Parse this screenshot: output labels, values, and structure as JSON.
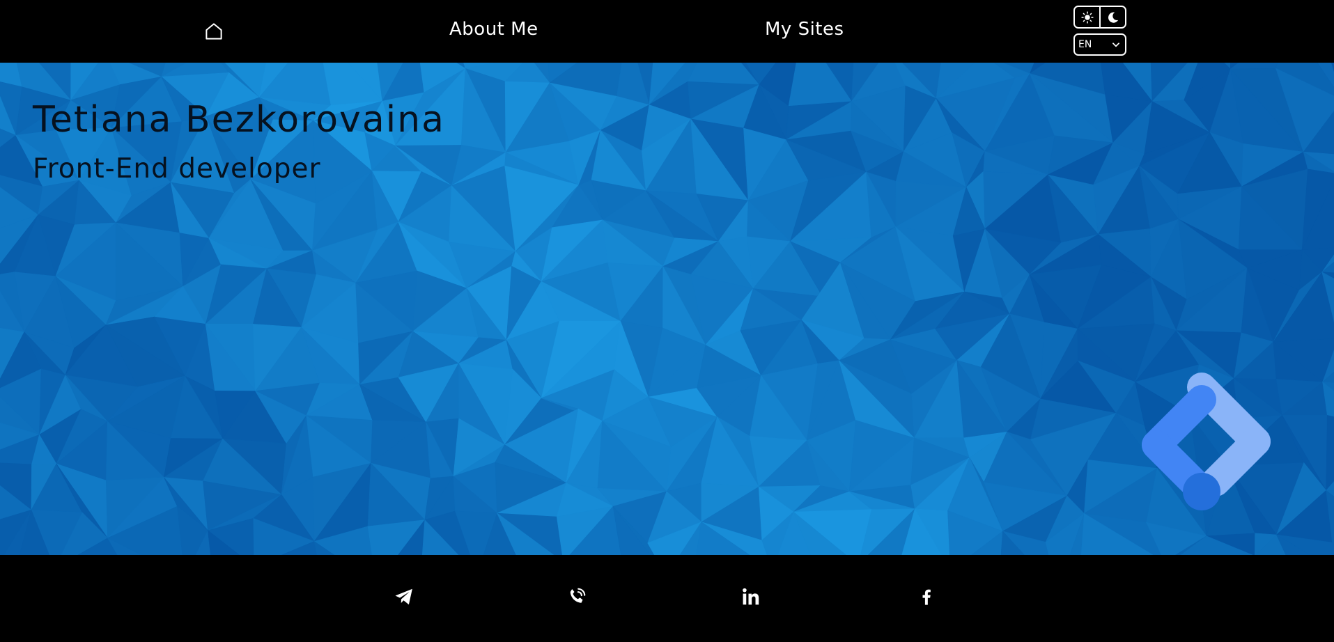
{
  "header": {
    "home_icon": "home-icon",
    "nav": [
      {
        "label": "About Me"
      },
      {
        "label": "My Sites"
      }
    ],
    "theme_toggle": {
      "light_icon": "sun-icon",
      "dark_icon": "moon-icon"
    },
    "language": {
      "selected": "EN",
      "icon": "chevron-down-icon"
    }
  },
  "hero": {
    "name": "Tetiana Bezkorovaina",
    "role": "Front-End developer",
    "logo": "google-tag-manager-logo",
    "colors": {
      "background": "#0a7acb",
      "text": "#06111f",
      "logo_dark": "#4285f4",
      "logo_light": "#8ab4f8",
      "logo_dot": "#246fdb"
    }
  },
  "footer": {
    "social": [
      {
        "icon": "telegram-icon"
      },
      {
        "icon": "phone-icon"
      },
      {
        "icon": "linkedin-icon"
      },
      {
        "icon": "facebook-icon"
      }
    ]
  }
}
